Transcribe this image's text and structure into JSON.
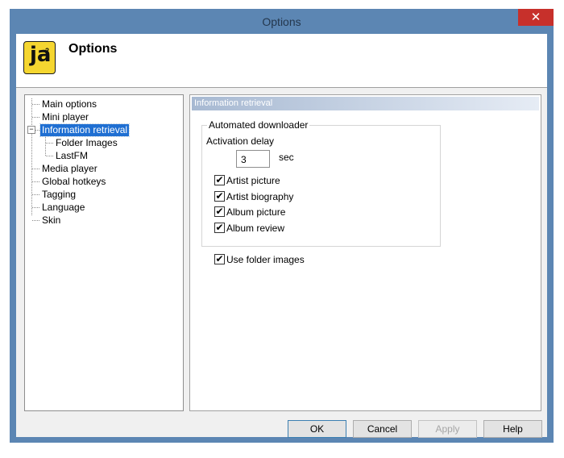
{
  "window": {
    "title": "Options",
    "close_symbol": "✕"
  },
  "header": {
    "logo_letters": "ja",
    "logo_sup": "2",
    "title": "Options"
  },
  "tree": {
    "items": [
      {
        "label": "Main options"
      },
      {
        "label": "Mini player"
      },
      {
        "label": "Information retrieval",
        "selected": true,
        "expander": "−"
      },
      {
        "label": "Folder Images"
      },
      {
        "label": "LastFM"
      },
      {
        "label": "Media player"
      },
      {
        "label": "Global hotkeys"
      },
      {
        "label": "Tagging"
      },
      {
        "label": "Language"
      },
      {
        "label": "Skin"
      }
    ]
  },
  "panel": {
    "header": "Information retrieval",
    "group_title": "Automated downloader",
    "activation_label": "Activation delay",
    "delay_value": "3",
    "delay_unit": "sec",
    "checkboxes": [
      {
        "label": "Artist picture",
        "checked": true
      },
      {
        "label": "Artist biography",
        "checked": true
      },
      {
        "label": "Album picture",
        "checked": true
      },
      {
        "label": "Album review",
        "checked": true
      }
    ],
    "use_folder_images": {
      "label": "Use folder images",
      "checked": true
    },
    "check_mark": "✔"
  },
  "buttons": {
    "ok": "OK",
    "cancel": "Cancel",
    "apply": "Apply",
    "help": "Help"
  }
}
